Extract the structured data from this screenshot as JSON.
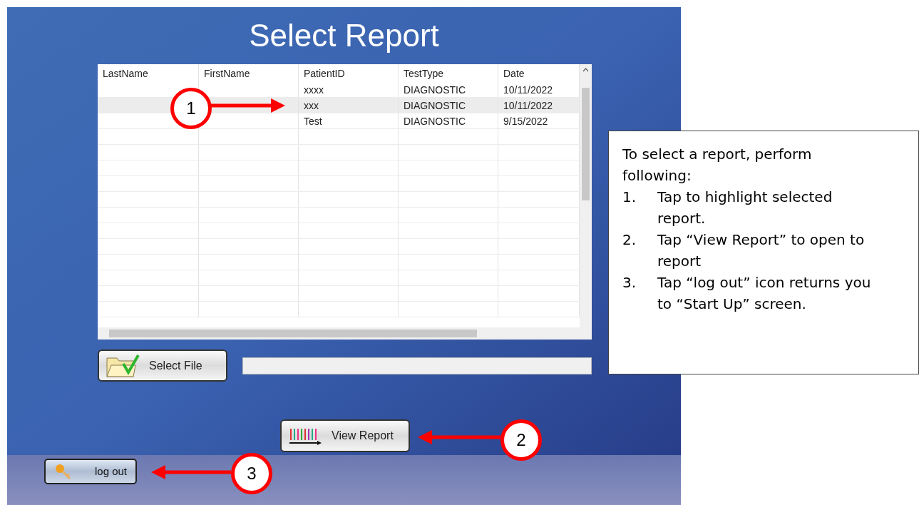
{
  "screen": {
    "title": "Select Report"
  },
  "table": {
    "columns": [
      "LastName",
      "FirstName",
      "PatientID",
      "TestType",
      "Date"
    ],
    "rows": [
      {
        "cells": [
          "",
          "",
          "xxxx",
          "DIAGNOSTIC",
          "10/11/2022"
        ],
        "selected": false
      },
      {
        "cells": [
          "",
          "",
          "xxx",
          "DIAGNOSTIC",
          "10/11/2022"
        ],
        "selected": true
      },
      {
        "cells": [
          "",
          "",
          "Test",
          "DIAGNOSTIC",
          "9/15/2022"
        ],
        "selected": false
      }
    ]
  },
  "select_file_button": {
    "label": "Select File"
  },
  "view_report_button": {
    "label": "View Report"
  },
  "logout_button": {
    "label": "log out"
  },
  "callouts": [
    "1",
    "2",
    "3"
  ],
  "instructions": {
    "intro": "To select a report, perform following:",
    "steps": [
      {
        "number": "1.",
        "text": "Tap to highlight selected report."
      },
      {
        "number": "2.",
        "text": "Tap “View Report” to open to report"
      },
      {
        "number": "3.",
        "text": "Tap “log out” icon returns you to “Start Up” screen."
      }
    ]
  }
}
